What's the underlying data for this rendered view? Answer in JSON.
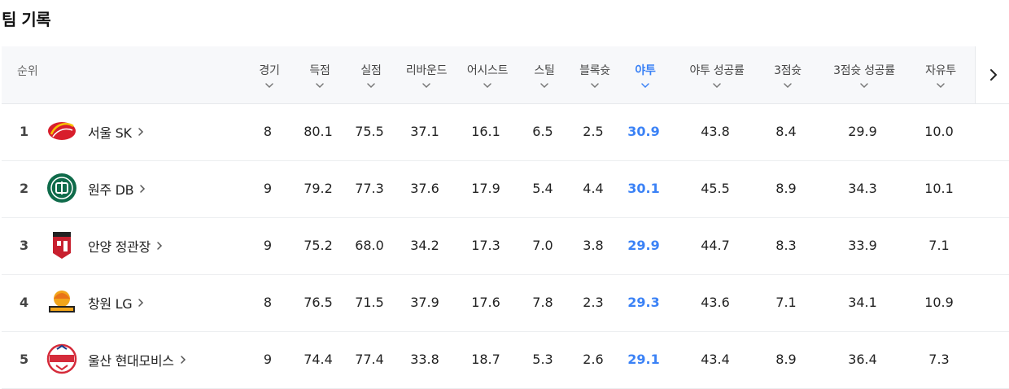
{
  "page": {
    "title": "팀 기록"
  },
  "table": {
    "rank_header": "순위",
    "columns": [
      {
        "key": "games",
        "label": "경기"
      },
      {
        "key": "points",
        "label": "득점"
      },
      {
        "key": "conceded",
        "label": "실점"
      },
      {
        "key": "rebounds",
        "label": "리바운드"
      },
      {
        "key": "assists",
        "label": "어시스트"
      },
      {
        "key": "steals",
        "label": "스틸"
      },
      {
        "key": "blocks",
        "label": "블록슛"
      },
      {
        "key": "fg",
        "label": "야투"
      },
      {
        "key": "fg_pct",
        "label": "야투 성공률"
      },
      {
        "key": "three",
        "label": "3점슛"
      },
      {
        "key": "three_pct",
        "label": "3점슛 성공률"
      },
      {
        "key": "ft",
        "label": "자유투"
      }
    ],
    "active_column": "야투",
    "rows": [
      {
        "rank": "1",
        "team": "서울 SK",
        "logo": "seoul-sk-logo",
        "values": [
          "8",
          "80.1",
          "75.5",
          "37.1",
          "16.1",
          "6.5",
          "2.5",
          "30.9",
          "43.8",
          "8.4",
          "29.9",
          "10.0"
        ]
      },
      {
        "rank": "2",
        "team": "원주 DB",
        "logo": "wonju-db-logo",
        "values": [
          "9",
          "79.2",
          "77.3",
          "37.6",
          "17.9",
          "5.4",
          "4.4",
          "30.1",
          "45.5",
          "8.9",
          "34.3",
          "10.1"
        ]
      },
      {
        "rank": "3",
        "team": "안양 정관장",
        "logo": "anyang-jkj-logo",
        "values": [
          "9",
          "75.2",
          "68.0",
          "34.2",
          "17.3",
          "7.0",
          "3.8",
          "29.9",
          "44.7",
          "8.3",
          "33.9",
          "7.1"
        ]
      },
      {
        "rank": "4",
        "team": "창원 LG",
        "logo": "changwon-lg-logo",
        "values": [
          "8",
          "76.5",
          "71.5",
          "37.9",
          "17.6",
          "7.8",
          "2.3",
          "29.3",
          "43.6",
          "7.1",
          "34.1",
          "10.9"
        ]
      },
      {
        "rank": "5",
        "team": "울산 현대모비스",
        "logo": "ulsan-mobis-logo",
        "values": [
          "9",
          "74.4",
          "77.4",
          "33.8",
          "18.7",
          "5.3",
          "2.6",
          "29.1",
          "43.4",
          "8.9",
          "36.4",
          "7.3"
        ]
      }
    ]
  },
  "colors": {
    "accent": "#3b82f6",
    "header_bg": "#f7f8fa",
    "sk_red": "#d81e2c",
    "db_green": "#0f6b4a",
    "jkj_red": "#c8202f",
    "lg_gold": "#f2a51a",
    "mobis_red": "#d52b3a"
  },
  "icons": {
    "sort": "chevron-down-icon",
    "team_link": "chevron-right-icon",
    "scroll": "chevron-right-icon"
  }
}
